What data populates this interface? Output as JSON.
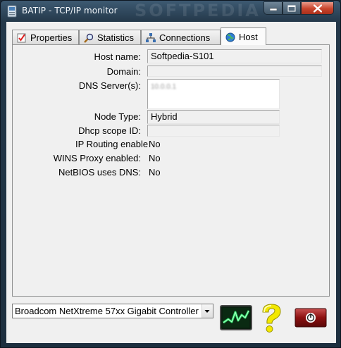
{
  "window": {
    "title": "BATIP - TCP/IP monitor",
    "watermark": "SOFTPEDIA"
  },
  "tabs": [
    {
      "label": "Properties",
      "icon": "checklist-icon",
      "active": false
    },
    {
      "label": "Statistics",
      "icon": "magnifier-icon",
      "active": false
    },
    {
      "label": "Connections",
      "icon": "network-icon",
      "active": false
    },
    {
      "label": "Host",
      "icon": "globe-icon",
      "active": true
    }
  ],
  "host": {
    "host_name_label": "Host name:",
    "host_name_value": "Softpedia-S101",
    "domain_label": "Domain:",
    "domain_value": "",
    "dns_label": "DNS Server(s):",
    "dns_value": "10.0.0.1",
    "node_type_label": "Node Type:",
    "node_type_value": "Hybrid",
    "dhcp_label": "Dhcp scope ID:",
    "dhcp_value": "",
    "ip_routing_label": "IP Routing enable",
    "ip_routing_value": "No",
    "wins_label": "WINS Proxy enabled:",
    "wins_value": "No",
    "netbios_label": "NetBIOS uses DNS:",
    "netbios_value": "No"
  },
  "adapter": {
    "selected": "Broadcom NetXtreme 57xx Gigabit Controller"
  },
  "buttons": [
    {
      "name": "monitor-button",
      "icon": "monitor-chart-icon"
    },
    {
      "name": "help-button",
      "icon": "question-mark-icon"
    },
    {
      "name": "power-button",
      "icon": "power-icon"
    }
  ],
  "colors": {
    "close_red": "#c8442c",
    "monitor_green": "#2ee06a",
    "help_yellow": "#f2e800",
    "power_red": "#8c1010"
  }
}
